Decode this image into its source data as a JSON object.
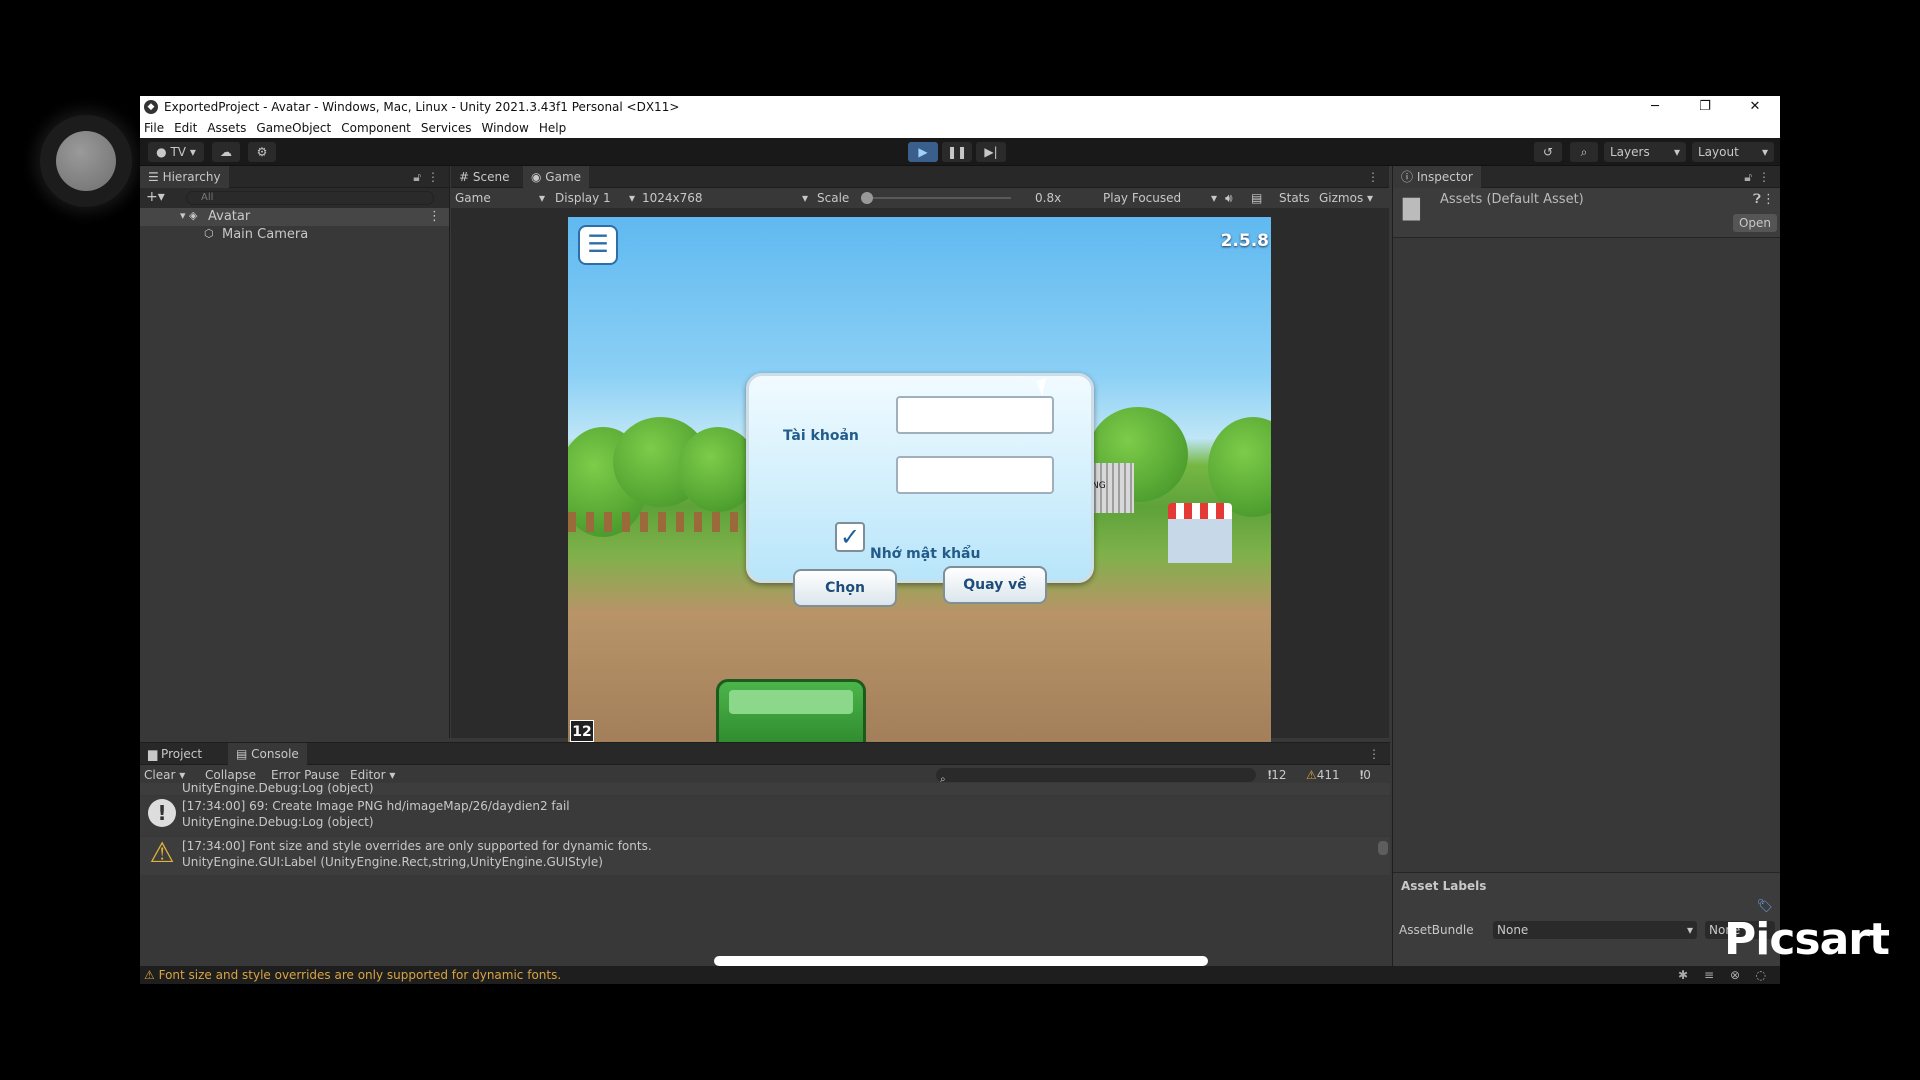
{
  "window": {
    "title": "ExportedProject - Avatar - Windows, Mac, Linux - Unity 2021.3.43f1 Personal <DX11>"
  },
  "menu": [
    "File",
    "Edit",
    "Assets",
    "GameObject",
    "Component",
    "Services",
    "Window",
    "Help"
  ],
  "toolbar": {
    "account": "TV",
    "layers": "Layers",
    "layout": "Layout"
  },
  "hierarchy": {
    "tab": "Hierarchy",
    "search_placeholder": "All",
    "root": "Avatar",
    "child": "Main Camera"
  },
  "game": {
    "tab_scene": "Scene",
    "tab_game": "Game",
    "view_mode": "Game",
    "display": "Display 1",
    "resolution": "1024x768",
    "scale_label": "Scale",
    "scale_value": "0.8x",
    "play_mode": "Play Focused",
    "stats": "Stats",
    "gizmos": "Gizmos",
    "version": "2.5.8",
    "age": "12",
    "account_label": "Tài khoản",
    "remember": "Nhớ mật khẩu",
    "btn_choose": "Chọn",
    "btn_back": "Quay về",
    "sign": "NG"
  },
  "inspector": {
    "tab": "Inspector",
    "asset_title": "Assets (Default Asset)",
    "open": "Open",
    "asset_labels": "Asset Labels",
    "asset_bundle_label": "AssetBundle",
    "asset_bundle_value": "None",
    "asset_variant": "None"
  },
  "bottom": {
    "tab_project": "Project",
    "tab_console": "Console",
    "clear": "Clear",
    "collapse": "Collapse",
    "error_pause": "Error Pause",
    "editor": "Editor",
    "count_log": "12",
    "count_warn": "411",
    "count_err": "0",
    "rows": [
      {
        "line1": "UnityEngine.Debug:Log (object)",
        "line2": ""
      },
      {
        "line1": "[17:34:00] 69: Create Image PNG hd/imageMap/26/daydien2 fail",
        "line2": "UnityEngine.Debug:Log (object)"
      },
      {
        "line1": "[17:34:00] Font size and style overrides are only supported for dynamic fonts.",
        "line2": "UnityEngine.GUI:Label (UnityEngine.Rect,string,UnityEngine.GUIStyle)"
      }
    ]
  },
  "status": {
    "message": "Font size and style overrides are only supported for dynamic fonts."
  },
  "watermark": "Picsart"
}
